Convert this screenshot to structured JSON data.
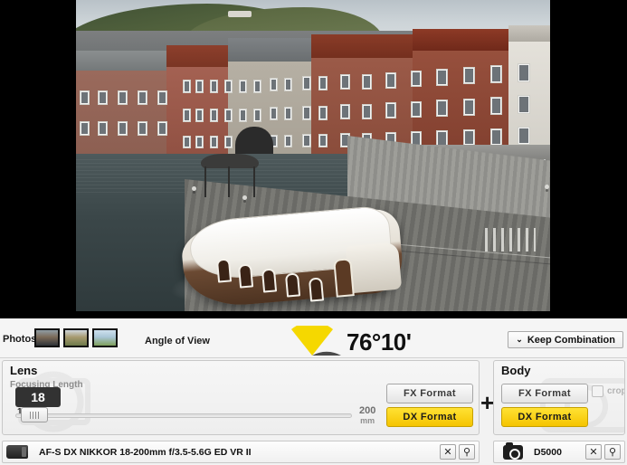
{
  "photo": {
    "alt_description": "Aerial view of a canal with brick townhouses and a white tour boat moored at a wooden dock",
    "background_color": "#000000"
  },
  "toolbar": {
    "photos_label": "Photos",
    "thumbnails": [
      {
        "name": "thumbnail-1",
        "selected": true
      },
      {
        "name": "thumbnail-2",
        "selected": false
      },
      {
        "name": "thumbnail-3",
        "selected": false
      }
    ],
    "angle_of_view_label": "Angle of View",
    "angle_of_view_value": "76°10'",
    "gauge_icon": "angle-of-view-gauge-icon",
    "gauge_active_color": "#f5d800",
    "gauge_inactive_color": "#4a4a4a",
    "keep_combination_label": "Keep Combination",
    "keep_combination_chevron": "⌄"
  },
  "lens_panel": {
    "title": "Lens",
    "focusing_length_label": "Focusing Length",
    "slider": {
      "tooltip_value": "18",
      "min_label": "18",
      "max_label": "200",
      "max_unit": "mm",
      "current_value": 18,
      "min": 18,
      "max": 200
    },
    "format_buttons": [
      {
        "label": "FX Format",
        "selected": false,
        "name": "lens-fx-format-button"
      },
      {
        "label": "DX Format",
        "selected": true,
        "name": "lens-dx-format-button"
      }
    ],
    "device": {
      "icon": "lens-icon",
      "name": "AF-S DX NIKKOR 18-200mm f/3.5-5.6G ED VR II",
      "clear_label": "✕",
      "search_label": "⚲"
    }
  },
  "separator": {
    "plus_symbol": "+"
  },
  "body_panel": {
    "title": "Body",
    "format_buttons": [
      {
        "label": "FX Format",
        "selected": false,
        "name": "body-fx-format-button"
      },
      {
        "label": "DX Format",
        "selected": true,
        "name": "body-dx-format-button"
      }
    ],
    "crop_checkbox": {
      "label": "crop",
      "checked": false,
      "enabled": false
    },
    "device": {
      "icon": "camera-icon",
      "name": "D5000",
      "clear_label": "✕",
      "search_label": "⚲"
    }
  },
  "colors": {
    "accent_yellow": "#f5c400",
    "panel_bg": "#f1f1f1",
    "border": "#c8c8c8",
    "text": "#111111",
    "muted_text": "#8c8c8c"
  }
}
